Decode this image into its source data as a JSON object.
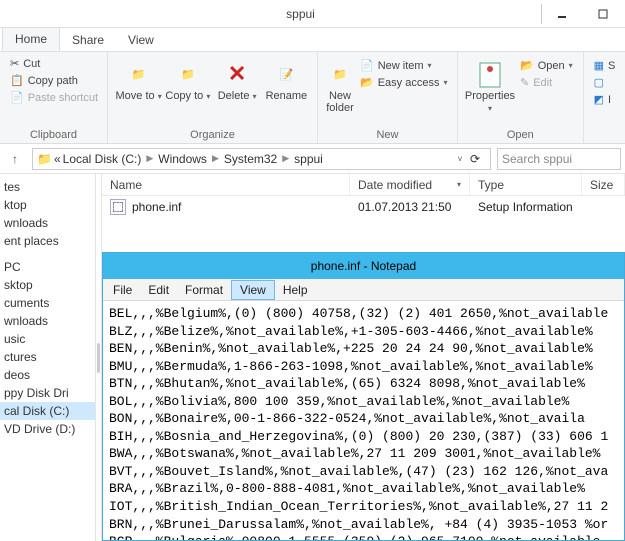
{
  "window": {
    "title": "sppui"
  },
  "tabs": {
    "home": "Home",
    "share": "Share",
    "view": "View"
  },
  "ribbon": {
    "clipboard": {
      "group": "Clipboard",
      "cut": "Cut",
      "copy_path": "Copy path",
      "paste_shortcut": "Paste shortcut"
    },
    "organize": {
      "group": "Organize",
      "move_to": "Move to",
      "copy_to": "Copy to",
      "delete": "Delete",
      "rename": "Rename"
    },
    "new": {
      "group": "New",
      "new_folder": "New folder",
      "new_item": "New item",
      "easy_access": "Easy access"
    },
    "open": {
      "group": "Open",
      "properties": "Properties",
      "open": "Open",
      "edit": "Edit"
    },
    "select": {
      "group": "",
      "select_all_icon": "S",
      "select_none_icon": "",
      "invert_icon": "I"
    }
  },
  "breadcrumb": {
    "parts": [
      "Local Disk (C:)",
      "Windows",
      "System32",
      "sppui"
    ],
    "prefix": "«"
  },
  "search": {
    "placeholder": "Search sppui"
  },
  "nav": {
    "items": [
      "tes",
      "ktop",
      "wnloads",
      "ent places",
      "",
      "",
      "PC",
      "sktop",
      "cuments",
      "wnloads",
      "usic",
      "ctures",
      "deos",
      "ppy Disk Dri",
      "cal Disk (C:)",
      "VD Drive (D:)"
    ]
  },
  "columns": {
    "name": "Name",
    "date": "Date modified",
    "type": "Type",
    "size": "Size"
  },
  "files": [
    {
      "name": "phone.inf",
      "date": "01.07.2013 21:50",
      "type": "Setup Information",
      "size": ""
    }
  ],
  "notepad": {
    "title": "phone.inf - Notepad",
    "menu": {
      "file": "File",
      "edit": "Edit",
      "format": "Format",
      "view": "View",
      "help": "Help"
    },
    "lines": [
      "BEL,,,%Belgium%,(0) (800) 40758,(32) (2) 401 2650,%not_available",
      "BLZ,,,%Belize%,%not_available%,+1-305-603-4466,%not_available%",
      "BEN,,,%Benin%,%not_available%,+225 20 24 24 90,%not_available%",
      "BMU,,,%Bermuda%,1-866-263-1098,%not_available%,%not_available%",
      "BTN,,,%Bhutan%,%not_available%,(65) 6324 8098,%not_available%",
      "BOL,,,%Bolivia%,800 100 359,%not_available%,%not_available%",
      "BON,,,%Bonaire%,00-1-866-322-0524,%not_available%,%not_availa",
      "BIH,,,%Bosnia_and_Herzegovina%,(0) (800) 20 230,(387) (33) 606 1",
      "BWA,,,%Botswana%,%not_available%,27 11 209 3001,%not_available%",
      "BVT,,,%Bouvet_Island%,%not_available%,(47) (23) 162 126,%not_ava",
      "BRA,,,%Brazil%,0-800-888-4081,%not_available%,%not_available%",
      "IOT,,,%British_Indian_Ocean_Territories%,%not_available%,27 11 2",
      "BRN,,,%Brunei_Darussalam%,%not_available%, +84 (4) 3935-1053 %or",
      "BGR,,,%Bulgaria%,00800 1 5555,(359) (2) 965 7100,%not_available"
    ]
  }
}
